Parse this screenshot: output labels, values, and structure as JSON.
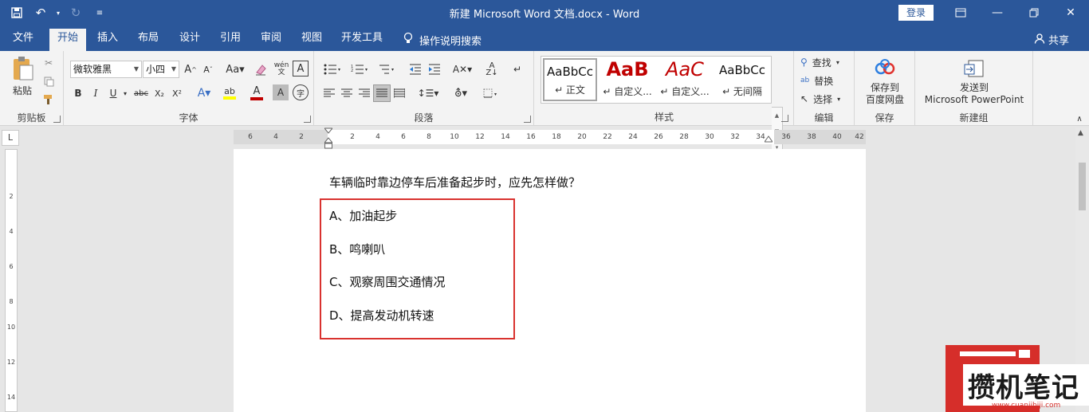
{
  "title_bar": {
    "title": "新建 Microsoft Word 文档.docx  -  Word",
    "login_label": "登录",
    "qat_icons": [
      "save-icon",
      "undo-icon",
      "redo-icon",
      "customize-icon"
    ]
  },
  "menu": {
    "tabs": [
      "文件",
      "开始",
      "插入",
      "布局",
      "设计",
      "引用",
      "审阅",
      "视图",
      "开发工具"
    ],
    "active_tab": "开始",
    "tell_me": "操作说明搜索",
    "share": "共享"
  },
  "ribbon": {
    "clipboard": {
      "paste_label": "粘贴",
      "group_label": "剪贴板"
    },
    "font": {
      "font_name": "微软雅黑",
      "font_size": "小四",
      "group_label": "字体",
      "format_buttons": [
        "B",
        "I",
        "U",
        "abc",
        "X₂",
        "X²"
      ],
      "phonetic_label": "wén",
      "char_border_label": "A",
      "font_color": "#c00000",
      "highlight_color": "#ffff00"
    },
    "paragraph": {
      "group_label": "段落"
    },
    "styles": {
      "group_label": "样式",
      "items": [
        {
          "sample": "AaBbCc",
          "name": "↵ 正文"
        },
        {
          "sample": "AaB",
          "name": "↵ 自定义..."
        },
        {
          "sample": "AaC",
          "name": "↵ 自定义..."
        },
        {
          "sample": "AaBbCc",
          "name": "↵ 无间隔"
        }
      ]
    },
    "editing": {
      "find": "查找",
      "replace": "替换",
      "select": "选择",
      "group_label": "编辑"
    },
    "save": {
      "button_label_1": "保存到",
      "button_label_2": "百度网盘",
      "group_label": "保存"
    },
    "new_group": {
      "button_label_1": "发送到",
      "button_label_2": "Microsoft PowerPoint",
      "group_label": "新建组"
    }
  },
  "ruler": {
    "corner": "L",
    "h_ticks": [
      "6",
      "4",
      "2",
      "2",
      "4",
      "6",
      "8",
      "10",
      "12",
      "14",
      "16",
      "18",
      "20",
      "22",
      "24",
      "26",
      "28",
      "30",
      "32",
      "34",
      "36",
      "38",
      "40",
      "42"
    ],
    "v_ticks": [
      "2",
      "4",
      "6",
      "8",
      "10",
      "12",
      "14"
    ]
  },
  "document": {
    "question": "车辆临时靠边停车后准备起步时，应先怎样做？",
    "options": [
      "A、加油起步",
      "B、鸣喇叭",
      "C、观察周围交通情况",
      "D、提高发动机转速"
    ],
    "highlight_color": "#d9322f"
  },
  "watermark": {
    "brand": "攒机笔记",
    "url": "www.cuanjibiji.com"
  }
}
